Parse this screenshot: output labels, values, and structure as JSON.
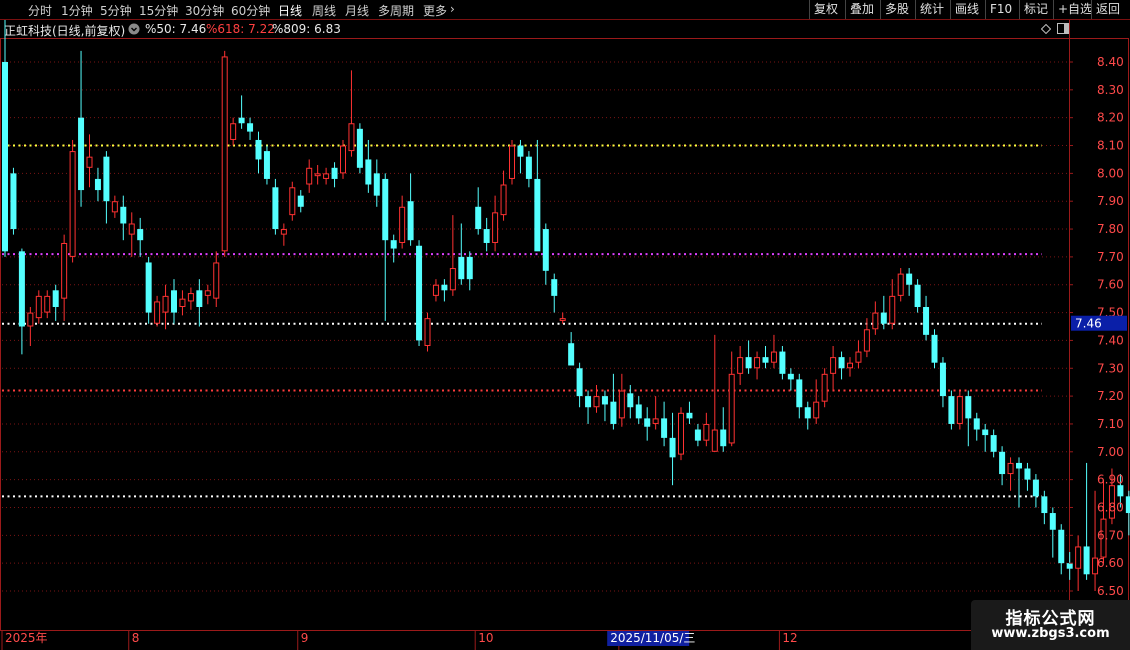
{
  "toolbar": {
    "periods": [
      "分时",
      "1分钟",
      "5分钟",
      "15分钟",
      "30分钟",
      "60分钟",
      "日线",
      "周线",
      "月线",
      "多周期",
      "更多"
    ],
    "active_period": "日线",
    "more_chevron": "›",
    "actions": [
      "复权",
      "叠加",
      "多股",
      "统计",
      "画线",
      "F10",
      "标记",
      "+自选",
      "返回"
    ]
  },
  "info": {
    "stock_title": "正虹科技(日线,前复权)",
    "indicator_1": "%50: 7.46",
    "indicator_2": "%618: 7.22",
    "indicator_3": "%809: 6.83"
  },
  "colors": {
    "up": "#ff3232",
    "down": "#54ffff",
    "frame": "#9b1a1a",
    "line_50": "#ffffff",
    "line_618": "#ff3c3c",
    "line_809": "#ffffff",
    "line_upper": "#ffff40",
    "line_magenta": "#e040ff"
  },
  "chart_data": {
    "type": "candlestick",
    "y_range": [
      6.45,
      8.5
    ],
    "y_ticks": [
      "8.40",
      "8.30",
      "8.20",
      "8.10",
      "8.00",
      "7.90",
      "7.80",
      "7.70",
      "7.60",
      "7.50",
      "7.40",
      "7.30",
      "7.20",
      "7.10",
      "7.00",
      "6.90",
      "6.80",
      "6.70",
      "6.60",
      "6.50"
    ],
    "current_price_label": "7.46",
    "x_labels": [
      {
        "text": "2025年",
        "index": 0
      },
      {
        "text": "8",
        "index": 15
      },
      {
        "text": "9",
        "index": 35
      },
      {
        "text": "10",
        "index": 56
      },
      {
        "text": "11",
        "index": 73
      }
    ],
    "crosshair_date": "2025/11/05/三",
    "crosshair_index": 76,
    "x_label_after": {
      "text": "12",
      "index": 92
    },
    "levels": [
      {
        "name": "upper",
        "value": 8.1,
        "color": "#ffff40"
      },
      {
        "name": "magenta",
        "value": 7.71,
        "color": "#e040ff"
      },
      {
        "name": "%50",
        "value": 7.46,
        "color": "#ffffff"
      },
      {
        "name": "%618",
        "value": 7.22,
        "color": "#ff3c3c"
      },
      {
        "name": "%809",
        "value": 6.84,
        "color": "#ffffff"
      }
    ],
    "candles": [
      [
        8.4,
        7.72,
        8.6,
        7.7
      ],
      [
        8.0,
        7.8,
        8.02,
        7.78
      ],
      [
        7.72,
        7.45,
        7.73,
        7.35
      ],
      [
        7.45,
        7.5,
        7.52,
        7.38
      ],
      [
        7.48,
        7.56,
        7.58,
        7.46
      ],
      [
        7.5,
        7.56,
        7.58,
        7.48
      ],
      [
        7.58,
        7.52,
        7.6,
        7.47
      ],
      [
        7.55,
        7.75,
        7.78,
        7.47
      ],
      [
        7.7,
        8.08,
        8.12,
        7.68
      ],
      [
        8.2,
        7.94,
        8.44,
        7.88
      ],
      [
        8.02,
        8.06,
        8.14,
        7.95
      ],
      [
        7.98,
        7.94,
        8.02,
        7.9
      ],
      [
        8.06,
        7.9,
        8.08,
        7.82
      ],
      [
        7.86,
        7.9,
        7.92,
        7.84
      ],
      [
        7.88,
        7.82,
        7.92,
        7.76
      ],
      [
        7.78,
        7.82,
        7.86,
        7.7
      ],
      [
        7.8,
        7.76,
        7.84,
        7.7
      ],
      [
        7.68,
        7.5,
        7.7,
        7.46
      ],
      [
        7.46,
        7.54,
        7.56,
        7.45
      ],
      [
        7.5,
        7.56,
        7.6,
        7.44
      ],
      [
        7.58,
        7.5,
        7.62,
        7.46
      ],
      [
        7.52,
        7.55,
        7.58,
        7.49
      ],
      [
        7.54,
        7.57,
        7.59,
        7.51
      ],
      [
        7.58,
        7.52,
        7.62,
        7.45
      ],
      [
        7.56,
        7.58,
        7.6,
        7.53
      ],
      [
        7.55,
        7.68,
        7.72,
        7.52
      ],
      [
        7.72,
        8.42,
        8.44,
        7.7
      ],
      [
        8.12,
        8.18,
        8.2,
        8.1
      ],
      [
        8.2,
        8.18,
        8.28,
        8.16
      ],
      [
        8.18,
        8.15,
        8.2,
        8.12
      ],
      [
        8.12,
        8.05,
        8.15,
        8.0
      ],
      [
        8.08,
        7.98,
        8.1,
        7.96
      ],
      [
        7.95,
        7.8,
        7.98,
        7.78
      ],
      [
        7.78,
        7.8,
        7.82,
        7.74
      ],
      [
        7.85,
        7.95,
        7.97,
        7.83
      ],
      [
        7.92,
        7.88,
        7.94,
        7.86
      ],
      [
        7.96,
        8.02,
        8.05,
        7.93
      ],
      [
        7.99,
        8.0,
        8.03,
        7.96
      ],
      [
        7.98,
        8.0,
        8.02,
        7.96
      ],
      [
        8.02,
        7.98,
        8.04,
        7.95
      ],
      [
        8.0,
        8.1,
        8.12,
        7.98
      ],
      [
        8.08,
        8.18,
        8.37,
        8.06
      ],
      [
        8.16,
        8.02,
        8.18,
        8.0
      ],
      [
        8.05,
        7.96,
        8.12,
        7.93
      ],
      [
        8.0,
        7.92,
        8.05,
        7.88
      ],
      [
        7.98,
        7.76,
        8.0,
        7.47
      ],
      [
        7.76,
        7.73,
        7.78,
        7.68
      ],
      [
        7.75,
        7.88,
        7.92,
        7.73
      ],
      [
        7.9,
        7.76,
        8.0,
        7.74
      ],
      [
        7.74,
        7.4,
        7.76,
        7.38
      ],
      [
        7.38,
        7.48,
        7.5,
        7.36
      ],
      [
        7.56,
        7.6,
        7.62,
        7.54
      ],
      [
        7.6,
        7.58,
        7.62,
        7.54
      ],
      [
        7.58,
        7.66,
        7.85,
        7.56
      ],
      [
        7.7,
        7.62,
        7.82,
        7.6
      ],
      [
        7.7,
        7.62,
        7.72,
        7.58
      ],
      [
        7.88,
        7.8,
        7.95,
        7.78
      ],
      [
        7.8,
        7.75,
        7.84,
        7.72
      ],
      [
        7.75,
        7.86,
        7.92,
        7.72
      ],
      [
        7.85,
        7.96,
        8.01,
        7.83
      ],
      [
        7.98,
        8.1,
        8.12,
        7.96
      ],
      [
        8.1,
        8.06,
        8.12,
        8.0
      ],
      [
        8.06,
        7.98,
        8.08,
        7.95
      ],
      [
        7.98,
        7.72,
        8.12,
        7.93
      ],
      [
        7.8,
        7.65,
        7.82,
        7.6
      ],
      [
        7.62,
        7.56,
        7.64,
        7.5
      ],
      [
        7.47,
        7.48,
        7.5,
        7.46
      ],
      [
        7.39,
        7.31,
        7.43,
        7.37
      ],
      [
        7.3,
        7.2,
        7.32,
        7.16
      ],
      [
        7.2,
        7.16,
        7.22,
        7.1
      ],
      [
        7.16,
        7.2,
        7.24,
        7.14
      ],
      [
        7.2,
        7.17,
        7.22,
        7.11
      ],
      [
        7.18,
        7.1,
        7.28,
        7.08
      ],
      [
        7.12,
        7.22,
        7.28,
        7.09
      ],
      [
        7.21,
        7.16,
        7.24,
        7.12
      ],
      [
        7.17,
        7.12,
        7.2,
        7.1
      ],
      [
        7.12,
        7.09,
        7.16,
        7.04
      ],
      [
        7.1,
        7.12,
        7.2,
        7.08
      ],
      [
        7.12,
        7.05,
        7.18,
        7.02
      ],
      [
        7.05,
        6.98,
        7.14,
        6.88
      ],
      [
        6.99,
        7.14,
        7.16,
        6.97
      ],
      [
        7.14,
        7.12,
        7.18,
        7.1
      ],
      [
        7.08,
        7.04,
        7.1,
        7.02
      ],
      [
        7.04,
        7.1,
        7.14,
        7.02
      ],
      [
        7.0,
        7.08,
        7.42,
        7.0
      ],
      [
        7.08,
        7.02,
        7.16,
        7.0
      ],
      [
        7.03,
        7.28,
        7.36,
        7.02
      ],
      [
        7.28,
        7.34,
        7.38,
        7.24
      ],
      [
        7.34,
        7.3,
        7.4,
        7.28
      ],
      [
        7.3,
        7.34,
        7.36,
        7.26
      ],
      [
        7.34,
        7.32,
        7.38,
        7.3
      ],
      [
        7.32,
        7.36,
        7.42,
        7.3
      ],
      [
        7.36,
        7.28,
        7.38,
        7.26
      ],
      [
        7.28,
        7.26,
        7.3,
        7.22
      ],
      [
        7.26,
        7.16,
        7.28,
        7.12
      ],
      [
        7.16,
        7.12,
        7.18,
        7.08
      ],
      [
        7.12,
        7.18,
        7.26,
        7.1
      ],
      [
        7.18,
        7.28,
        7.3,
        7.16
      ],
      [
        7.28,
        7.34,
        7.38,
        7.22
      ],
      [
        7.34,
        7.3,
        7.36,
        7.26
      ],
      [
        7.3,
        7.32,
        7.34,
        7.27
      ],
      [
        7.32,
        7.36,
        7.4,
        7.3
      ],
      [
        7.36,
        7.44,
        7.48,
        7.34
      ],
      [
        7.44,
        7.5,
        7.54,
        7.42
      ],
      [
        7.5,
        7.46,
        7.56,
        7.44
      ],
      [
        7.46,
        7.56,
        7.62,
        7.44
      ],
      [
        7.56,
        7.64,
        7.66,
        7.54
      ],
      [
        7.64,
        7.6,
        7.66,
        7.56
      ],
      [
        7.6,
        7.52,
        7.62,
        7.5
      ],
      [
        7.52,
        7.42,
        7.56,
        7.4
      ],
      [
        7.42,
        7.32,
        7.44,
        7.3
      ],
      [
        7.32,
        7.2,
        7.34,
        7.16
      ],
      [
        7.2,
        7.1,
        7.22,
        7.08
      ],
      [
        7.1,
        7.2,
        7.22,
        7.08
      ],
      [
        7.2,
        7.12,
        7.22,
        7.02
      ],
      [
        7.12,
        7.08,
        7.14,
        7.04
      ],
      [
        7.08,
        7.06,
        7.1,
        7.0
      ],
      [
        7.06,
        7.0,
        7.08,
        6.98
      ],
      [
        7.0,
        6.92,
        7.02,
        6.88
      ],
      [
        6.92,
        6.96,
        6.98,
        6.86
      ],
      [
        6.96,
        6.94,
        6.98,
        6.8
      ],
      [
        6.94,
        6.9,
        6.96,
        6.86
      ],
      [
        6.9,
        6.84,
        6.92,
        6.8
      ],
      [
        6.84,
        6.78,
        6.86,
        6.74
      ],
      [
        6.78,
        6.72,
        6.8,
        6.62
      ],
      [
        6.72,
        6.6,
        6.74,
        6.56
      ],
      [
        6.6,
        6.58,
        6.64,
        6.54
      ],
      [
        6.58,
        6.66,
        6.7,
        6.5
      ],
      [
        6.66,
        6.56,
        6.96,
        6.54
      ],
      [
        6.56,
        6.62,
        6.86,
        6.5
      ],
      [
        6.62,
        6.76,
        6.9,
        6.6
      ],
      [
        6.76,
        6.88,
        6.94,
        6.74
      ],
      [
        6.88,
        6.84,
        6.92,
        6.8
      ],
      [
        6.84,
        6.78,
        6.86,
        6.7
      ]
    ]
  },
  "watermark": {
    "title": "指标公式网",
    "url": "www.zbgs3.com"
  }
}
